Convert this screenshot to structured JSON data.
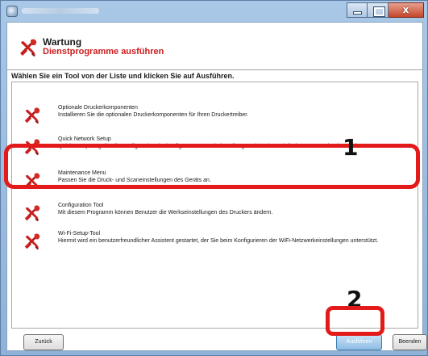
{
  "window": {
    "title": "",
    "close_glyph": "x"
  },
  "header": {
    "title": "Wartung",
    "subtitle": "Dienstprogramme ausführen",
    "icon": "tools-icon"
  },
  "instruction": "Wählen Sie ein Tool von der Liste und klicken Sie auf Ausführen.",
  "tools": [
    {
      "name": "Optionale Druckerkomponenten",
      "description": "Installieren Sie die optionalen Druckerkomponenten für Ihren Druckertreiber.",
      "icon": "tools-icon"
    },
    {
      "name": "Quick Network Setup",
      "description": "Quick Setup sorgt für die Konfiguration der häufigsten Netzwerkeinstellungen über einen einfach zu verwendenden Assistenten.",
      "icon": "tools-icon"
    },
    {
      "name": "Maintenance Menu",
      "description": "Passen Sie die Druck- und Scaneinstellungen des Geräts an.",
      "icon": "tools-icon"
    },
    {
      "name": "Configuration Tool",
      "description": "Mit diesem Programm können Benutzer die Werkseinstellungen des Druckers ändern.",
      "icon": "tools-icon"
    },
    {
      "name": "Wi-Fi-Setup-Tool",
      "description": "Hiermit wird ein benutzerfreundlicher Assistent gestartet, der Sie beim Konfigurieren der WiFi-Netzwerkeinstellungen unterstützt.",
      "icon": "tools-icon"
    }
  ],
  "callouts": {
    "step1": "1",
    "step2": "2",
    "color": "#e21a1a"
  },
  "buttons": {
    "back": "Zurück",
    "run": "Ausführen",
    "end": "Beenden"
  },
  "colors": {
    "subtitle": "#cc1d1d",
    "icon_red": "#c8201e",
    "highlight": "#e21a1a"
  }
}
